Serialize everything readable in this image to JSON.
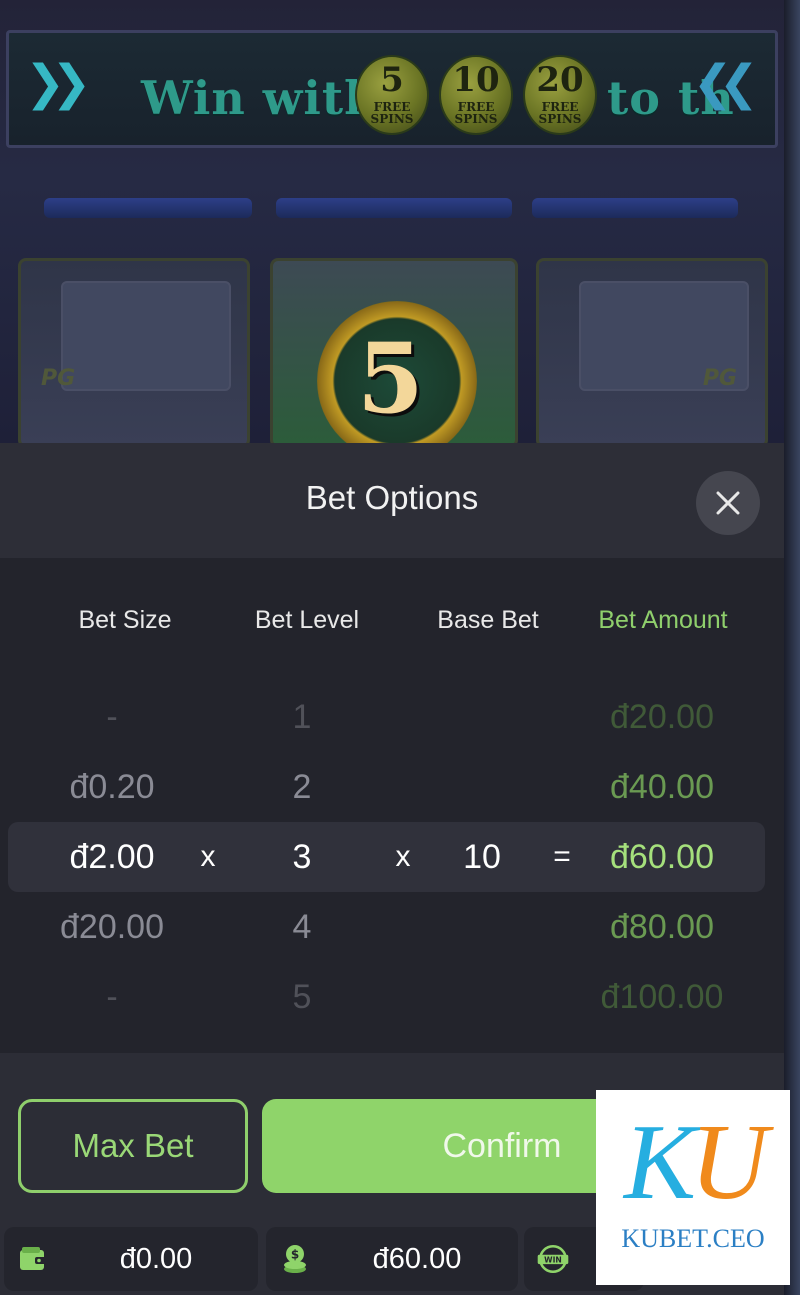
{
  "game": {
    "banner_text_start": "Win with",
    "banner_text_end": "to th",
    "spin_coins": [
      {
        "number": "5",
        "label": "FREE SPINS"
      },
      {
        "number": "10",
        "label": "FREE SPINS"
      },
      {
        "number": "20",
        "label": "FREE SPINS"
      }
    ],
    "reel_brand": "PG",
    "reel_symbol": "5"
  },
  "bet_options": {
    "title": "Bet Options",
    "columns": {
      "bet_size": "Bet Size",
      "bet_level": "Bet Level",
      "base_bet": "Base Bet",
      "bet_amount": "Bet Amount"
    },
    "rows": [
      {
        "bet_size": "-",
        "bet_level": "1",
        "bet_amount": "đ20.00"
      },
      {
        "bet_size": "đ0.20",
        "bet_level": "2",
        "bet_amount": "đ40.00"
      },
      {
        "bet_size": "đ2.00",
        "bet_level": "3",
        "base_bet": "10",
        "bet_amount": "đ60.00",
        "op_multiply": "x",
        "op_equals": "="
      },
      {
        "bet_size": "đ20.00",
        "bet_level": "4",
        "bet_amount": "đ80.00"
      },
      {
        "bet_size": "-",
        "bet_level": "5",
        "bet_amount": "đ100.00"
      }
    ],
    "max_bet_label": "Max Bet",
    "confirm_label": "Confirm"
  },
  "status_bar": {
    "balance": "đ0.00",
    "bet": "đ60.00",
    "win_icon_label": "WIN"
  },
  "watermark": {
    "letters_k": "K",
    "letters_u": "U",
    "domain": "KUBET.CEO"
  },
  "colors": {
    "accent_green": "#8fd46a",
    "panel_bg": "#2c2d36",
    "table_bg": "#23242c"
  }
}
